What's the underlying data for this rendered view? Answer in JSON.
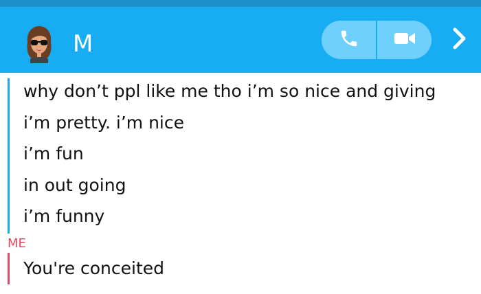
{
  "header": {
    "contact_name": "M",
    "avatar_icon": "bitmoji-avatar-icon",
    "call_icon": "phone-icon",
    "video_icon": "video-camera-icon",
    "forward_icon": "chevron-right-icon",
    "colors": {
      "header_bg": "#18adf2",
      "top_strip": "#1f8fc9",
      "call_pill": "#6ed0fb"
    }
  },
  "conversation": {
    "them_messages": [
      "why don’t ppl like me tho i’m so nice and giving",
      "i’m pretty. i’m nice",
      "i’m fun",
      "in out going",
      "i’m funny"
    ],
    "me_label": "ME",
    "me_messages": [
      "You're conceited"
    ],
    "colors": {
      "them_accent": "#1aa8ee",
      "me_accent": "#e8475f"
    }
  }
}
